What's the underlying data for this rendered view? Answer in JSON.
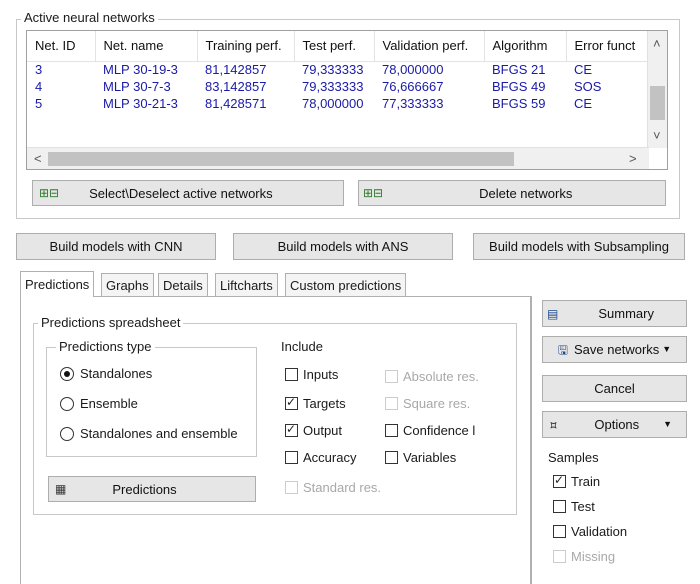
{
  "active_networks": {
    "title": "Active neural networks",
    "columns": [
      "Net. ID",
      "Net. name",
      "Training perf.",
      "Test perf.",
      "Validation perf.",
      "Algorithm",
      "Error funct"
    ],
    "rows": [
      [
        "3",
        "MLP 30-19-3",
        "81,142857",
        "79,333333",
        "78,000000",
        "BFGS 21",
        "CE"
      ],
      [
        "4",
        "MLP 30-7-3",
        "83,142857",
        "79,333333",
        "76,666667",
        "BFGS 49",
        "SOS"
      ],
      [
        "5",
        "MLP 30-21-3",
        "81,428571",
        "78,000000",
        "77,333333",
        "BFGS 59",
        "CE"
      ]
    ],
    "select_button": "Select\\Deselect active networks",
    "delete_button": "Delete networks"
  },
  "build_buttons": {
    "cnn": "Build models with CNN",
    "ans": "Build  models with ANS",
    "subsampling": "Build models with Subsampling"
  },
  "tabs": [
    "Predictions",
    "Graphs",
    "Details",
    "Liftcharts",
    "Custom predictions"
  ],
  "predictions": {
    "spreadsheet_title": "Predictions spreadsheet",
    "type_title": "Predictions type",
    "types": [
      "Standalones",
      "Ensemble",
      "Standalones and ensemble"
    ],
    "selected_type": "Standalones",
    "include_title": "Include",
    "include_left": [
      {
        "label": "Inputs",
        "checked": false
      },
      {
        "label": "Targets",
        "checked": true
      },
      {
        "label": "Output",
        "checked": true
      },
      {
        "label": "Accuracy",
        "checked": false
      }
    ],
    "include_right": [
      {
        "label": "Absolute res.",
        "checked": false,
        "disabled": true
      },
      {
        "label": "Square res.",
        "checked": false,
        "disabled": true
      },
      {
        "label": "Confidence l",
        "checked": false,
        "disabled": false
      },
      {
        "label": "Variables",
        "checked": false,
        "disabled": false
      }
    ],
    "standard_res": "Standard res.",
    "predictions_button": "Predictions"
  },
  "side": {
    "summary": "Summary",
    "save_networks": "Save networks",
    "cancel": "Cancel",
    "options": "Options",
    "samples_title": "Samples",
    "samples": [
      {
        "label": "Train",
        "checked": true,
        "disabled": false
      },
      {
        "label": "Test",
        "checked": false,
        "disabled": false
      },
      {
        "label": "Validation",
        "checked": false,
        "disabled": false
      },
      {
        "label": "Missing",
        "checked": false,
        "disabled": true
      }
    ]
  }
}
